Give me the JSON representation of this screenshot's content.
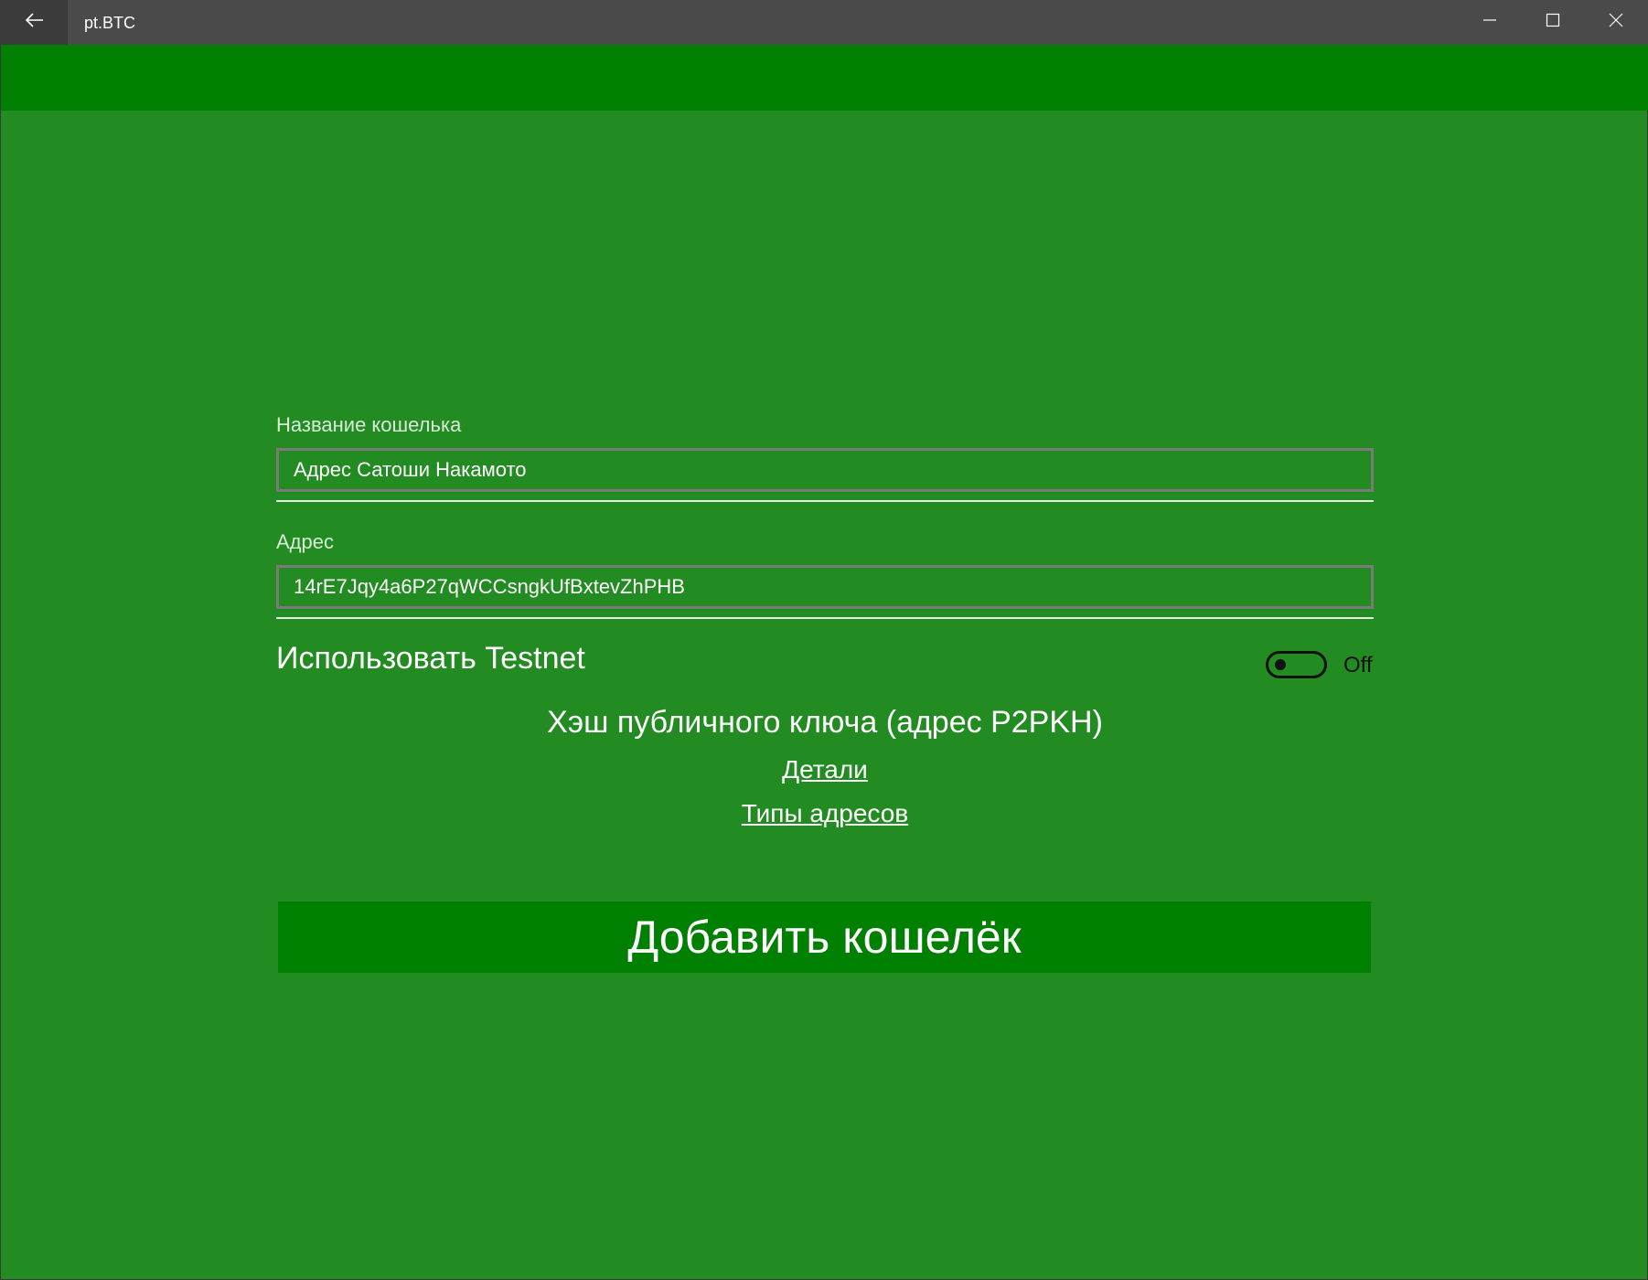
{
  "window": {
    "title": "pt.BTC",
    "back_icon": "back-arrow-icon",
    "controls": [
      "minimize-icon",
      "maximize-icon",
      "close-icon"
    ]
  },
  "colors": {
    "titlebar": "#4a4a4a",
    "header_band": "#008000",
    "background": "#228b22",
    "button": "#008000"
  },
  "form": {
    "name_label": "Название кошелька",
    "name_value": "Адрес Сатоши Накамото",
    "address_label": "Адрес",
    "address_value": "14rE7Jqy4a6P27qWCCsngkUfBxtevZhPHB",
    "testnet_label": "Использовать Testnet",
    "testnet_state": "Off",
    "address_type": "Хэш публичного ключа (адрес P2PKH)",
    "details_link": "Детали",
    "address_types_link": "Типы адресов",
    "submit_label": "Добавить кошелёк"
  }
}
